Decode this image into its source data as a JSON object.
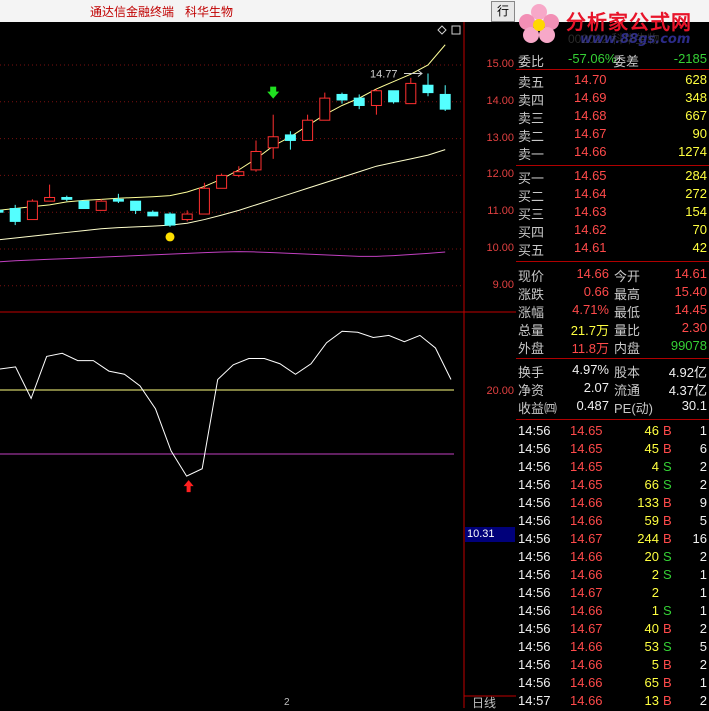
{
  "titlebar": {
    "app_name": "通达信金融终端",
    "stock_name": "科华生物",
    "menu_button": "行"
  },
  "logo": {
    "text": "分析家公式网",
    "url": "www.88gs.com",
    "stock_line": "002022 科华生物"
  },
  "chart": {
    "price_axis": [
      "15.00",
      "14.00",
      "13.00",
      "12.00",
      "11.00",
      "10.00",
      "9.00"
    ],
    "indicator_axis": "20.00",
    "current_value": "10.31",
    "high_label": "14.77",
    "period": "日线",
    "x_marker": "2",
    "colors": {
      "up": "#ff3030",
      "down": "#54ffff",
      "ma_short": "#ffff99",
      "ma_long": "#ffffcc",
      "ma_pink": "#c040c0"
    },
    "candles": [
      {
        "o": 11.05,
        "h": 11.15,
        "l": 10.95,
        "c": 11.0
      },
      {
        "o": 11.1,
        "h": 11.2,
        "l": 10.65,
        "c": 10.75
      },
      {
        "o": 10.8,
        "h": 11.35,
        "l": 10.8,
        "c": 11.3
      },
      {
        "o": 11.3,
        "h": 11.75,
        "l": 11.3,
        "c": 11.4
      },
      {
        "o": 11.4,
        "h": 11.45,
        "l": 11.3,
        "c": 11.35
      },
      {
        "o": 11.3,
        "h": 11.3,
        "l": 11.1,
        "c": 11.1
      },
      {
        "o": 11.05,
        "h": 11.35,
        "l": 11.05,
        "c": 11.3
      },
      {
        "o": 11.35,
        "h": 11.5,
        "l": 11.25,
        "c": 11.3
      },
      {
        "o": 11.3,
        "h": 11.3,
        "l": 10.95,
        "c": 11.05
      },
      {
        "o": 11.0,
        "h": 11.05,
        "l": 10.9,
        "c": 10.9
      },
      {
        "o": 10.95,
        "h": 11.0,
        "l": 10.6,
        "c": 10.65
      },
      {
        "o": 10.8,
        "h": 11.05,
        "l": 10.75,
        "c": 10.95
      },
      {
        "o": 10.95,
        "h": 11.8,
        "l": 10.95,
        "c": 11.65
      },
      {
        "o": 11.65,
        "h": 12.05,
        "l": 11.65,
        "c": 12.0
      },
      {
        "o": 12.0,
        "h": 12.25,
        "l": 11.95,
        "c": 12.1
      },
      {
        "o": 12.15,
        "h": 12.95,
        "l": 12.1,
        "c": 12.65
      },
      {
        "o": 12.75,
        "h": 13.65,
        "l": 12.45,
        "c": 13.05
      },
      {
        "o": 13.1,
        "h": 13.2,
        "l": 12.7,
        "c": 12.95
      },
      {
        "o": 12.95,
        "h": 13.65,
        "l": 12.95,
        "c": 13.5
      },
      {
        "o": 13.5,
        "h": 14.25,
        "l": 13.5,
        "c": 14.1
      },
      {
        "o": 14.2,
        "h": 14.25,
        "l": 13.95,
        "c": 14.05
      },
      {
        "o": 14.1,
        "h": 14.2,
        "l": 13.8,
        "c": 13.9
      },
      {
        "o": 13.9,
        "h": 14.35,
        "l": 13.65,
        "c": 14.3
      },
      {
        "o": 14.3,
        "h": 14.3,
        "l": 13.95,
        "c": 14.0
      },
      {
        "o": 13.95,
        "h": 14.65,
        "l": 13.95,
        "c": 14.5
      },
      {
        "o": 14.45,
        "h": 14.77,
        "l": 14.15,
        "c": 14.25
      },
      {
        "o": 14.2,
        "h": 14.45,
        "l": 13.75,
        "c": 13.8
      }
    ],
    "ma_short": [
      11.05,
      11.1,
      11.15,
      11.2,
      11.28,
      11.32,
      11.35,
      11.38,
      11.4,
      11.42,
      11.45,
      11.55,
      11.7,
      11.9,
      12.15,
      12.45,
      12.8,
      13.05,
      13.35,
      13.65,
      13.9,
      14.1,
      14.35,
      14.55,
      14.75,
      15.0,
      15.55
    ],
    "ma_long": [
      10.25,
      10.3,
      10.35,
      10.4,
      10.45,
      10.5,
      10.55,
      10.58,
      10.6,
      10.62,
      10.65,
      10.7,
      10.8,
      10.92,
      11.05,
      11.2,
      11.35,
      11.5,
      11.65,
      11.8,
      11.95,
      12.1,
      12.25,
      12.35,
      12.45,
      12.55,
      12.7
    ],
    "ma_pink": [
      9.65,
      9.68,
      9.7,
      9.72,
      9.74,
      9.76,
      9.78,
      9.8,
      9.82,
      9.84,
      9.86,
      9.88,
      9.9,
      9.92,
      9.93,
      9.92,
      9.9,
      9.88,
      9.86,
      9.84,
      9.82,
      9.8,
      9.8,
      9.82,
      9.85,
      9.88,
      9.92
    ],
    "indicator": [
      40,
      42,
      12,
      52,
      55,
      48,
      48,
      38,
      35,
      24,
      2,
      -38,
      -62,
      -55,
      30,
      44,
      50,
      50,
      45,
      35,
      45,
      65,
      76,
      75,
      70,
      72,
      66,
      72,
      60,
      30
    ],
    "signals": {
      "buy_index": 10,
      "sell_index": 16
    }
  },
  "sidebar": {
    "wei_bi": {
      "label": "委比",
      "value": "-57.06%",
      "label2": "委差",
      "value2": "-2185"
    },
    "asks": [
      {
        "label": "卖五",
        "price": "14.70",
        "vol": "628"
      },
      {
        "label": "卖四",
        "price": "14.69",
        "vol": "348"
      },
      {
        "label": "卖三",
        "price": "14.68",
        "vol": "667"
      },
      {
        "label": "卖二",
        "price": "14.67",
        "vol": "90"
      },
      {
        "label": "卖一",
        "price": "14.66",
        "vol": "1274"
      }
    ],
    "bids": [
      {
        "label": "买一",
        "price": "14.65",
        "vol": "284"
      },
      {
        "label": "买二",
        "price": "14.64",
        "vol": "272"
      },
      {
        "label": "买三",
        "price": "14.63",
        "vol": "154"
      },
      {
        "label": "买四",
        "price": "14.62",
        "vol": "70"
      },
      {
        "label": "买五",
        "price": "14.61",
        "vol": "42"
      }
    ],
    "quote": [
      {
        "l1": "现价",
        "v1": "14.66",
        "l2": "今开",
        "v2": "14.61"
      },
      {
        "l1": "涨跌",
        "v1": "0.66",
        "l2": "最高",
        "v2": "15.40"
      },
      {
        "l1": "涨幅",
        "v1": "4.71%",
        "l2": "最低",
        "v2": "14.45"
      },
      {
        "l1": "总量",
        "v1": "21.7万",
        "l2": "量比",
        "v2": "2.30"
      },
      {
        "l1": "外盘",
        "v1": "11.8万",
        "l2": "内盘",
        "v2": "99078"
      }
    ],
    "finance": [
      {
        "l1": "换手",
        "v1": "4.97%",
        "l2": "股本",
        "v2": "4.92亿"
      },
      {
        "l1": "净资",
        "v1": "2.07",
        "l2": "流通",
        "v2": "4.37亿"
      },
      {
        "l1": "收益㈣",
        "v1": "0.487",
        "l2": "PE(动)",
        "v2": "30.1"
      }
    ],
    "ticks": [
      {
        "time": "14:56",
        "price": "14.65",
        "vol": "46",
        "side": "B",
        "count": "1"
      },
      {
        "time": "14:56",
        "price": "14.65",
        "vol": "45",
        "side": "B",
        "count": "6"
      },
      {
        "time": "14:56",
        "price": "14.65",
        "vol": "4",
        "side": "S",
        "count": "2"
      },
      {
        "time": "14:56",
        "price": "14.65",
        "vol": "66",
        "side": "S",
        "count": "2"
      },
      {
        "time": "14:56",
        "price": "14.66",
        "vol": "133",
        "side": "B",
        "count": "9"
      },
      {
        "time": "14:56",
        "price": "14.66",
        "vol": "59",
        "side": "B",
        "count": "5"
      },
      {
        "time": "14:56",
        "price": "14.67",
        "vol": "244",
        "side": "B",
        "count": "16"
      },
      {
        "time": "14:56",
        "price": "14.66",
        "vol": "20",
        "side": "S",
        "count": "2"
      },
      {
        "time": "14:56",
        "price": "14.66",
        "vol": "2",
        "side": "S",
        "count": "1"
      },
      {
        "time": "14:56",
        "price": "14.67",
        "vol": "2",
        "side": "",
        "count": "1"
      },
      {
        "time": "14:56",
        "price": "14.66",
        "vol": "1",
        "side": "S",
        "count": "1"
      },
      {
        "time": "14:56",
        "price": "14.67",
        "vol": "40",
        "side": "B",
        "count": "2"
      },
      {
        "time": "14:56",
        "price": "14.66",
        "vol": "53",
        "side": "S",
        "count": "5"
      },
      {
        "time": "14:56",
        "price": "14.66",
        "vol": "5",
        "side": "B",
        "count": "2"
      },
      {
        "time": "14:56",
        "price": "14.66",
        "vol": "65",
        "side": "B",
        "count": "1"
      },
      {
        "time": "14:57",
        "price": "14.66",
        "vol": "13",
        "side": "B",
        "count": "2"
      }
    ]
  }
}
